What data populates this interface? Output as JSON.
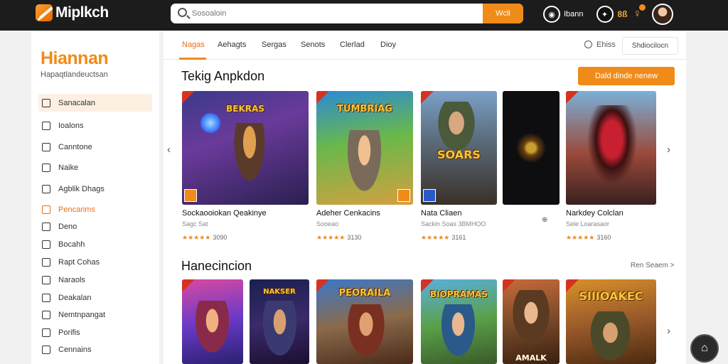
{
  "header": {
    "app_title": "Miplkch",
    "search_placeholder": "Sosoaloin",
    "search_button": "Wcli",
    "user_label": "Ibann",
    "badge_label": "8ß",
    "icons": [
      "logo-icon",
      "search-icon",
      "user-circle-icon",
      "badge-icon",
      "bell-icon",
      "avatar"
    ]
  },
  "sidebar": {
    "title": "Hiannan",
    "subtitle": "Hapaqtlandeuctsan",
    "items": [
      {
        "label": "Sanacalan",
        "state": "selected"
      },
      {
        "label": "Ioalons"
      },
      {
        "label": "Canntone"
      },
      {
        "label": "Naike"
      },
      {
        "label": "Agblik Dhags"
      },
      {
        "label": "Pencarims",
        "state": "accent"
      },
      {
        "label": "Deno"
      },
      {
        "label": "Bocahh"
      },
      {
        "label": "Rapt Cohas"
      },
      {
        "label": "Naraols"
      },
      {
        "label": "Deakalan"
      },
      {
        "label": "Nemtnpangat"
      },
      {
        "label": "Porifis"
      },
      {
        "label": "Cennains"
      }
    ]
  },
  "tabs": [
    "Nagas",
    "Aehagts",
    "Sergas",
    "Senots",
    "Clerlad",
    "Dioy"
  ],
  "toolbar": {
    "sort_label": "Ehiss",
    "filter_label": "Shdiocilocn"
  },
  "sections": {
    "top": {
      "title": "Tekig Anpkdon",
      "cta": "Dald dinde nenew"
    },
    "bottom": {
      "title": "Hanecincion",
      "see_all": "Ren Seaem >"
    }
  },
  "top_apps": [
    {
      "name": "Sockaooiokan Qeakinye",
      "sub": "Sagc Sat",
      "rating": "★★★★★",
      "count": "3090",
      "art": "BEKRAS"
    },
    {
      "name": "Adeher Cenkacins",
      "sub": "Sooeao",
      "rating": "★★★★★",
      "count": "3130",
      "art": "TUMBRIAG"
    },
    {
      "name": "Nata Cliaen",
      "sub": "Sackin Soas 3BMHOO",
      "rating": "★★★★★",
      "count": "3161",
      "art": "SOARS"
    },
    {
      "name": "",
      "sub": "",
      "rating": "",
      "count": "",
      "art": ""
    },
    {
      "name": "Narkdey Colclan",
      "sub": "Sele Loarasaor",
      "rating": "★★★★★",
      "count": "3160",
      "art": ""
    }
  ],
  "bottom_apps": [
    {
      "art": ""
    },
    {
      "art": "NAKSER"
    },
    {
      "art": "PEORAILA"
    },
    {
      "art": "BIOPRAMAS"
    },
    {
      "art": "AMALK"
    },
    {
      "art": "SIIIOAKEC"
    }
  ],
  "colors": {
    "accent": "#f08b1a",
    "topbar": "#1c1c1c",
    "sidebar_selected": "#fdf0e2"
  }
}
